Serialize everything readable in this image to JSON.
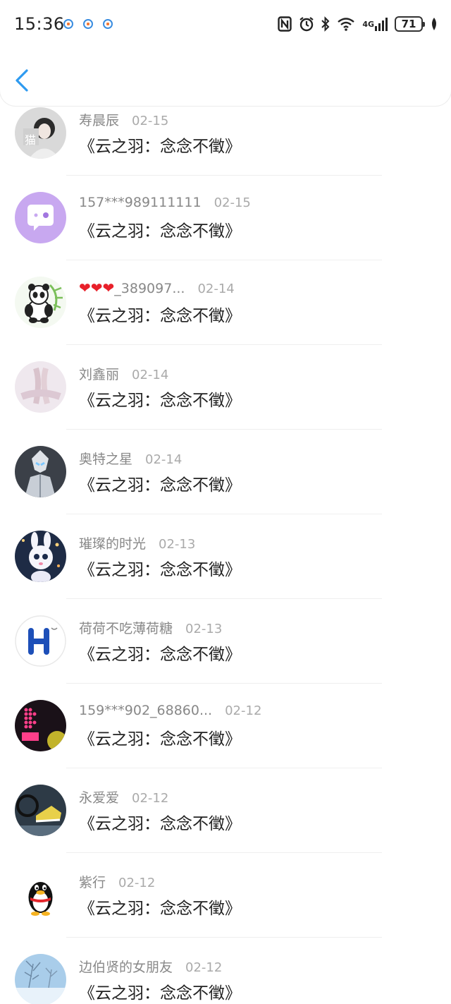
{
  "status_bar": {
    "time": "15:36",
    "network": "4G",
    "battery": "71"
  },
  "icons": {
    "back": "chevron-left-icon",
    "nfc": "nfc-icon",
    "alarm": "alarm-icon",
    "bluetooth": "bluetooth-icon",
    "wifi": "wifi-icon",
    "signal": "signal-icon",
    "leaf": "leaf-icon"
  },
  "colors": {
    "accent": "#2e9af0",
    "name_gray": "#888888",
    "date_gray": "#aaaaaa"
  },
  "comments": [
    {
      "name": "寿晨辰",
      "date": "02-15",
      "text": "《云之羽：念念不徵》",
      "avatar": "photo-portrait"
    },
    {
      "name": "157***989111111",
      "date": "02-15",
      "text": "《云之羽：念念不徵》",
      "avatar": "chat-bubble-purple"
    },
    {
      "name": "❤❤❤_389097...",
      "date": "02-14",
      "text": "《云之羽：念念不徵》",
      "avatar": "panda"
    },
    {
      "name": "刘鑫丽",
      "date": "02-14",
      "text": "《云之羽：念念不徵》",
      "avatar": "photo-hands"
    },
    {
      "name": "奥特之星",
      "date": "02-14",
      "text": "《云之羽：念念不徵》",
      "avatar": "photo-hero"
    },
    {
      "name": "璀璨的时光",
      "date": "02-13",
      "text": "《云之羽：念念不徵》",
      "avatar": "photo-bunny"
    },
    {
      "name": "荷荷不吃薄荷糖",
      "date": "02-13",
      "text": "《云之羽：念念不徵》",
      "avatar": "letter-h"
    },
    {
      "name": "159***902_68860...",
      "date": "02-12",
      "text": "《云之羽：念念不徵》",
      "avatar": "photo-dots"
    },
    {
      "name": "永爱爱",
      "date": "02-12",
      "text": "《云之羽：念念不徵》",
      "avatar": "photo-shoe"
    },
    {
      "name": "紫行",
      "date": "02-12",
      "text": "《云之羽：念念不徵》",
      "avatar": "penguin"
    },
    {
      "name": "边伯贤的女朋友",
      "date": "02-12",
      "text": "《云之羽：念念不徵》",
      "avatar": "photo-snow"
    }
  ]
}
